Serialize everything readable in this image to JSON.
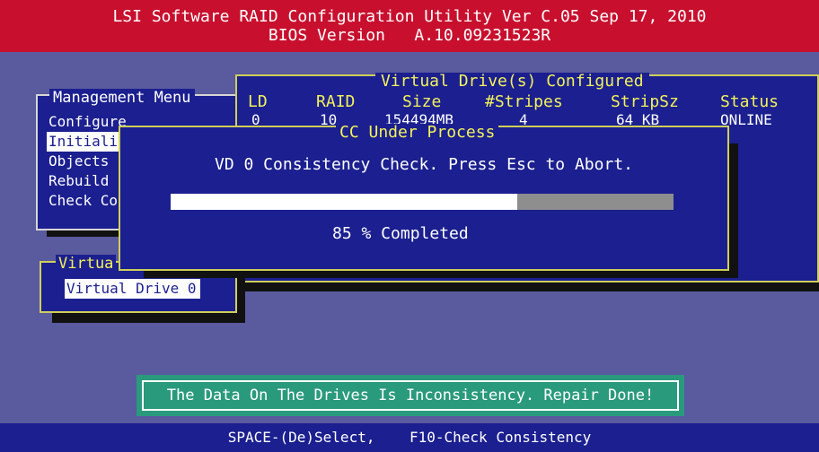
{
  "title": {
    "line1": "LSI Software RAID Configuration Utility Ver C.05 Sep 17, 2010",
    "line2": "BIOS Version   A.10.09231523R"
  },
  "management_menu": {
    "title": "Management Menu",
    "items": [
      "Configure",
      "Initiali",
      "Objects",
      "Rebuild",
      "Check Co"
    ],
    "selected_index": 1
  },
  "virtual_drives_configured": {
    "title": "Virtual Drive(s) Configured",
    "columns": [
      "LD",
      "RAID",
      "Size",
      "#Stripes",
      "StripSz",
      "Status"
    ],
    "rows": [
      [
        "0",
        "10",
        "154494MB",
        "4",
        "64 KB",
        "ONLINE"
      ]
    ]
  },
  "virtual_drives_box": {
    "title": "Virtua",
    "item": "Virtual Drive 0"
  },
  "cc_dialog": {
    "title": "CC Under Process",
    "message": "VD 0 Consistency Check. Press Esc to Abort.",
    "progress_percent": 85,
    "progress_text": "85 % Completed"
  },
  "result_message": "The Data On The Drives Is Inconsistency. Repair Done!",
  "status_bar": "SPACE-(De)Select,    F10-Check Consistency",
  "colors": {
    "background": "#5a5a9e",
    "title_bar": "#c8102e",
    "panel": "#1b1f8f",
    "frame": "#cfcf5a",
    "header_text": "#f2f25a",
    "result_panel": "#2a9a7c"
  }
}
